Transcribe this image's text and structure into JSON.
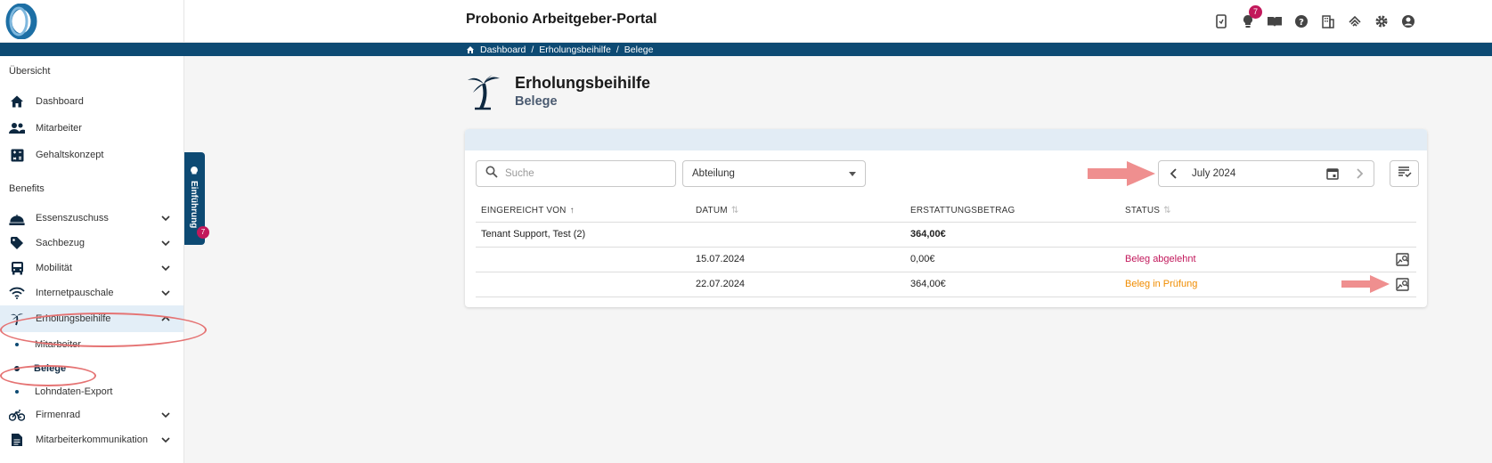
{
  "header": {
    "title": "Probonio Arbeitgeber-Portal",
    "notification_count": "7",
    "icons": [
      "mobile-icon",
      "lightbulb-icon",
      "book-icon",
      "help-icon",
      "building-icon",
      "fingerprint-icon",
      "settings-icon",
      "account-icon"
    ]
  },
  "breadcrumb": {
    "items": [
      "Dashboard",
      "Erholungsbeihilfe",
      "Belege"
    ],
    "sep": "/"
  },
  "sidebar": {
    "section_overview": "Übersicht",
    "overview_items": [
      {
        "label": "Dashboard",
        "icon": "home-icon"
      },
      {
        "label": "Mitarbeiter",
        "icon": "people-icon"
      },
      {
        "label": "Gehaltskonzept",
        "icon": "calculator-icon"
      }
    ],
    "section_benefits": "Benefits",
    "benefit_items": [
      {
        "label": "Essenszuschuss",
        "icon": "food-icon"
      },
      {
        "label": "Sachbezug",
        "icon": "tag-icon"
      },
      {
        "label": "Mobilität",
        "icon": "bus-icon"
      },
      {
        "label": "Internetpauschale",
        "icon": "wifi-icon"
      },
      {
        "label": "Erholungsbeihilfe",
        "icon": "palm-tree-icon"
      }
    ],
    "sub_items": [
      "Mitarbeiter",
      "Belege",
      "Lohndaten-Export"
    ],
    "more_items": [
      {
        "label": "Firmenrad",
        "icon": "bike-icon"
      },
      {
        "label": "Mitarbeiterkommunikation",
        "icon": "document-icon"
      }
    ]
  },
  "intro_tab": {
    "label": "Einführung",
    "badge": "7"
  },
  "page": {
    "title": "Erholungsbeihilfe",
    "subtitle": "Belege"
  },
  "filters": {
    "search_placeholder": "Suche",
    "department_value": "Abteilung",
    "month_value": "July 2024"
  },
  "table": {
    "headers": [
      "EINGEREICHT VON",
      "DATUM",
      "ERSTATTUNGSBETRAG",
      "STATUS"
    ],
    "group_row": {
      "name": "Tenant Support, Test (2)",
      "total": "364,00€"
    },
    "rows": [
      {
        "date": "15.07.2024",
        "amount": "0,00€",
        "status": "Beleg abgelehnt"
      },
      {
        "date": "22.07.2024",
        "amount": "364,00€",
        "status": "Beleg in Prüfung"
      }
    ]
  },
  "colors": {
    "primary": "#0d4a73",
    "badge": "#c2185b",
    "rejected": "#c2185b",
    "in_review": "#f08c00",
    "annotation": "#e57373"
  }
}
